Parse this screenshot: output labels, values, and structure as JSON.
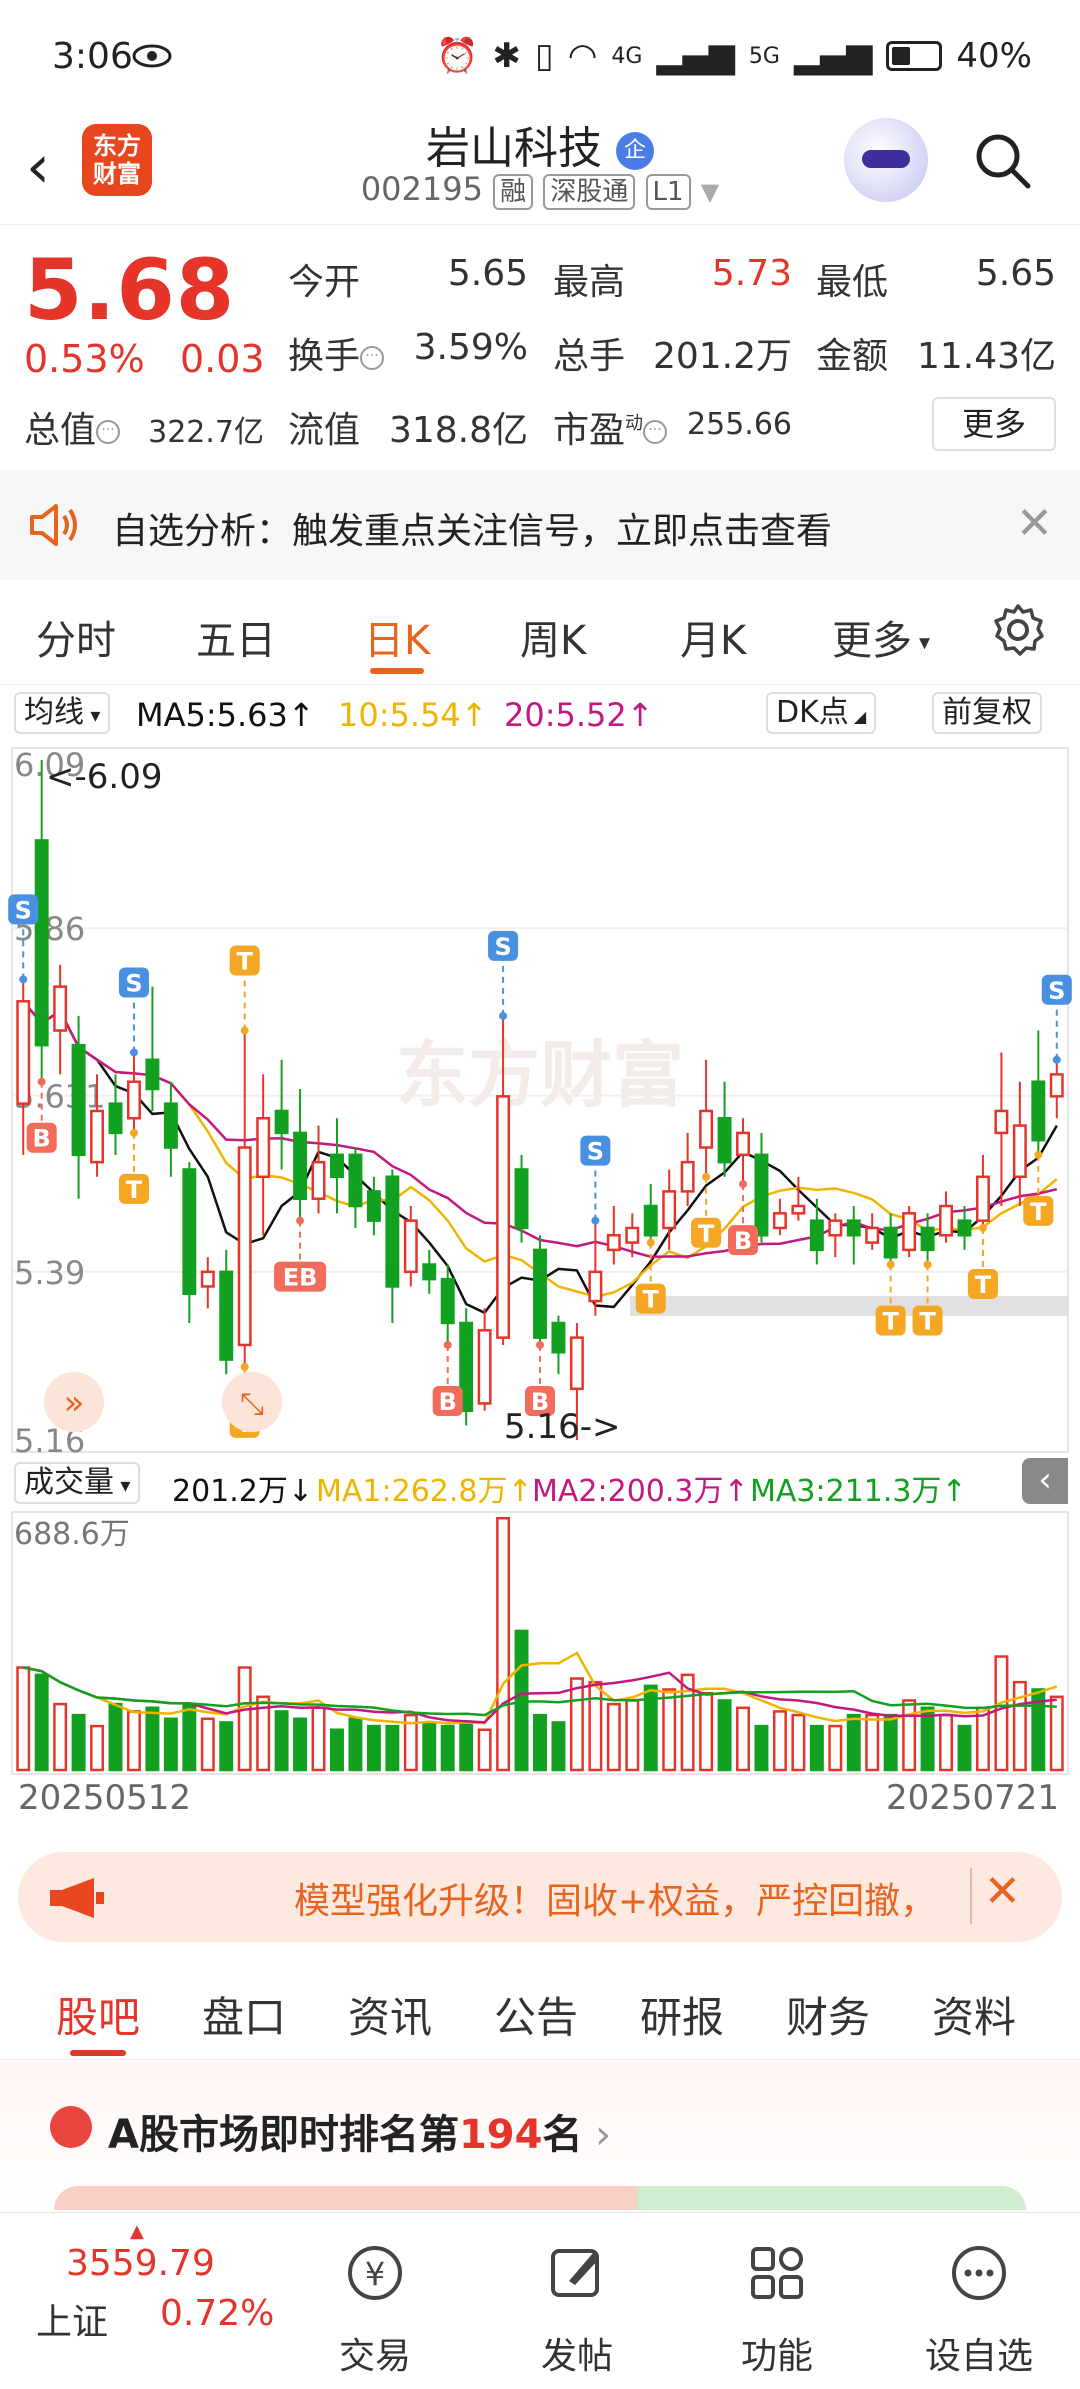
{
  "status_bar": {
    "time": "3:06",
    "network_a": "4G",
    "network_b": "5G",
    "battery": "40%"
  },
  "header": {
    "app_logo": "东方\n财富",
    "stock_name": "岩山科技",
    "ent_badge": "企",
    "stock_code": "002195",
    "tags": [
      "融",
      "深股通",
      "L1"
    ]
  },
  "quote": {
    "price": "5.68",
    "change_pct": "0.53%",
    "change": "0.03",
    "open_label": "今开",
    "open": "5.65",
    "high_label": "最高",
    "high": "5.73",
    "low_label": "最低",
    "low": "5.65",
    "turnover_label": "换手",
    "turnover": "3.59%",
    "volume_label": "总手",
    "volume": "201.2万",
    "amount_label": "金额",
    "amount": "11.43亿",
    "mktcap_label": "总值",
    "mktcap": "322.7亿",
    "float_label": "流值",
    "float": "318.8亿",
    "pe_label": "市盈",
    "pe_sup": "动",
    "pe": "255.66",
    "more_label": "更多"
  },
  "notice": {
    "text": "自选分析：触发重点关注信号，立即点击查看"
  },
  "tabs": {
    "items": [
      "分时",
      "五日",
      "日K",
      "周K",
      "月K",
      "更多"
    ],
    "active": "日K"
  },
  "ma_row": {
    "selector": "均线",
    "ma5": "MA5:5.63",
    "ma10": "10:5.54",
    "ma20": "20:5.52",
    "dk": "DK点",
    "fq": "前复权"
  },
  "kline": {
    "y_labels": [
      "6.09",
      "5.86",
      "5.631",
      "5.39",
      "5.16"
    ],
    "max_label": "<-6.09",
    "min_label": "5.16->",
    "watermark": "东方财富",
    "markers": [
      "S",
      "B",
      "T",
      "EB"
    ]
  },
  "vol_row": {
    "selector": "成交量",
    "vol": "201.2万",
    "ma1": "MA1:262.8万",
    "ma2": "MA2:200.3万",
    "ma3": "MA3:211.3万",
    "vol_max": "688.6万"
  },
  "dates": {
    "start": "20250512",
    "end": "20250721"
  },
  "promo": {
    "text": "模型强化升级！固收+权益，严控回撤，"
  },
  "sub_tabs": [
    "股吧",
    "盘口",
    "资讯",
    "公告",
    "研报",
    "财务",
    "资料"
  ],
  "rank": {
    "prefix": "A股市场即时排名第",
    "num": "194",
    "suffix": "名"
  },
  "bottom_nav": {
    "index_value": "3559.79",
    "index_name": "上证",
    "index_change": "0.72%",
    "items": [
      "交易",
      "发帖",
      "功能",
      "设自选"
    ]
  },
  "colors": {
    "up": "#e5342a",
    "down": "#12a020",
    "accent": "#e8641e",
    "ma5": "#111111",
    "ma10": "#f0b400",
    "ma20": "#c2187f"
  },
  "chart_data": {
    "type": "candlestick",
    "period": "daily",
    "ylim": [
      5.16,
      6.09
    ],
    "max_price": 6.09,
    "min_price": 5.16,
    "ma": {
      "ma5": 5.63,
      "ma10": 5.54,
      "ma20": 5.52
    },
    "candles": [
      {
        "o": 5.62,
        "c": 5.76,
        "h": 5.79,
        "l": 5.55
      },
      {
        "o": 5.98,
        "c": 5.7,
        "h": 6.09,
        "l": 5.65
      },
      {
        "o": 5.72,
        "c": 5.78,
        "h": 5.81,
        "l": 5.66
      },
      {
        "o": 5.7,
        "c": 5.55,
        "h": 5.74,
        "l": 5.49
      },
      {
        "o": 5.54,
        "c": 5.61,
        "h": 5.66,
        "l": 5.52
      },
      {
        "o": 5.62,
        "c": 5.58,
        "h": 5.66,
        "l": 5.55
      },
      {
        "o": 5.6,
        "c": 5.65,
        "h": 5.69,
        "l": 5.58
      },
      {
        "o": 5.68,
        "c": 5.64,
        "h": 5.78,
        "l": 5.61
      },
      {
        "o": 5.62,
        "c": 5.56,
        "h": 5.65,
        "l": 5.52
      },
      {
        "o": 5.53,
        "c": 5.36,
        "h": 5.54,
        "l": 5.32
      },
      {
        "o": 5.37,
        "c": 5.39,
        "h": 5.41,
        "l": 5.34
      },
      {
        "o": 5.39,
        "c": 5.27,
        "h": 5.42,
        "l": 5.25
      },
      {
        "o": 5.29,
        "c": 5.56,
        "h": 5.72,
        "l": 5.26
      },
      {
        "o": 5.52,
        "c": 5.6,
        "h": 5.66,
        "l": 5.44
      },
      {
        "o": 5.61,
        "c": 5.58,
        "h": 5.68,
        "l": 5.53
      },
      {
        "o": 5.58,
        "c": 5.49,
        "h": 5.64,
        "l": 5.46
      },
      {
        "o": 5.49,
        "c": 5.54,
        "h": 5.59,
        "l": 5.47
      },
      {
        "o": 5.55,
        "c": 5.52,
        "h": 5.6,
        "l": 5.47
      },
      {
        "o": 5.55,
        "c": 5.48,
        "h": 5.56,
        "l": 5.45
      },
      {
        "o": 5.5,
        "c": 5.46,
        "h": 5.52,
        "l": 5.44
      },
      {
        "o": 5.52,
        "c": 5.37,
        "h": 5.53,
        "l": 5.32
      },
      {
        "o": 5.39,
        "c": 5.46,
        "h": 5.48,
        "l": 5.37
      },
      {
        "o": 5.4,
        "c": 5.38,
        "h": 5.42,
        "l": 5.36
      },
      {
        "o": 5.38,
        "c": 5.32,
        "h": 5.4,
        "l": 5.29
      },
      {
        "o": 5.32,
        "c": 5.2,
        "h": 5.34,
        "l": 5.18
      },
      {
        "o": 5.21,
        "c": 5.31,
        "h": 5.34,
        "l": 5.2
      },
      {
        "o": 5.3,
        "c": 5.63,
        "h": 5.74,
        "l": 5.29
      },
      {
        "o": 5.53,
        "c": 5.45,
        "h": 5.55,
        "l": 5.43
      },
      {
        "o": 5.42,
        "c": 5.3,
        "h": 5.44,
        "l": 5.29
      },
      {
        "o": 5.32,
        "c": 5.28,
        "h": 5.33,
        "l": 5.25
      },
      {
        "o": 5.23,
        "c": 5.3,
        "h": 5.32,
        "l": 5.16
      },
      {
        "o": 5.35,
        "c": 5.39,
        "h": 5.46,
        "l": 5.33
      },
      {
        "o": 5.42,
        "c": 5.44,
        "h": 5.48,
        "l": 5.4
      },
      {
        "o": 5.43,
        "c": 5.45,
        "h": 5.47,
        "l": 5.41
      },
      {
        "o": 5.48,
        "c": 5.44,
        "h": 5.51,
        "l": 5.43
      },
      {
        "o": 5.45,
        "c": 5.5,
        "h": 5.53,
        "l": 5.42
      },
      {
        "o": 5.5,
        "c": 5.54,
        "h": 5.58,
        "l": 5.48
      },
      {
        "o": 5.56,
        "c": 5.61,
        "h": 5.68,
        "l": 5.52
      },
      {
        "o": 5.6,
        "c": 5.54,
        "h": 5.65,
        "l": 5.52
      },
      {
        "o": 5.55,
        "c": 5.58,
        "h": 5.6,
        "l": 5.51
      },
      {
        "o": 5.55,
        "c": 5.44,
        "h": 5.58,
        "l": 5.43
      },
      {
        "o": 5.45,
        "c": 5.47,
        "h": 5.49,
        "l": 5.44
      },
      {
        "o": 5.47,
        "c": 5.48,
        "h": 5.52,
        "l": 5.46
      },
      {
        "o": 5.46,
        "c": 5.42,
        "h": 5.49,
        "l": 5.4
      },
      {
        "o": 5.44,
        "c": 5.46,
        "h": 5.47,
        "l": 5.41
      },
      {
        "o": 5.46,
        "c": 5.44,
        "h": 5.48,
        "l": 5.4
      },
      {
        "o": 5.43,
        "c": 5.45,
        "h": 5.47,
        "l": 5.42
      },
      {
        "o": 5.45,
        "c": 5.41,
        "h": 5.47,
        "l": 5.4
      },
      {
        "o": 5.42,
        "c": 5.47,
        "h": 5.48,
        "l": 5.41
      },
      {
        "o": 5.45,
        "c": 5.42,
        "h": 5.47,
        "l": 5.4
      },
      {
        "o": 5.44,
        "c": 5.48,
        "h": 5.5,
        "l": 5.43
      },
      {
        "o": 5.46,
        "c": 5.44,
        "h": 5.48,
        "l": 5.42
      },
      {
        "o": 5.46,
        "c": 5.52,
        "h": 5.55,
        "l": 5.45
      },
      {
        "o": 5.58,
        "c": 5.61,
        "h": 5.69,
        "l": 5.48
      },
      {
        "o": 5.52,
        "c": 5.59,
        "h": 5.65,
        "l": 5.48
      },
      {
        "o": 5.65,
        "c": 5.57,
        "h": 5.72,
        "l": 5.55
      },
      {
        "o": 5.63,
        "c": 5.66,
        "h": 5.68,
        "l": 5.6
      }
    ],
    "volume_unit": "万",
    "volume_max": 688.6,
    "volumes": [
      280,
      260,
      180,
      150,
      120,
      180,
      160,
      170,
      140,
      180,
      140,
      130,
      280,
      200,
      160,
      140,
      170,
      110,
      140,
      120,
      120,
      150,
      130,
      120,
      130,
      110,
      688,
      380,
      150,
      130,
      250,
      240,
      180,
      190,
      230,
      220,
      260,
      210,
      190,
      170,
      120,
      160,
      150,
      120,
      120,
      150,
      150,
      150,
      190,
      170,
      150,
      120,
      170,
      310,
      240,
      220,
      200
    ],
    "ma_vol": {
      "ma1": 262.8,
      "ma2": 200.3,
      "ma3": 211.3
    },
    "x_range": [
      "20250512",
      "20250721"
    ]
  }
}
